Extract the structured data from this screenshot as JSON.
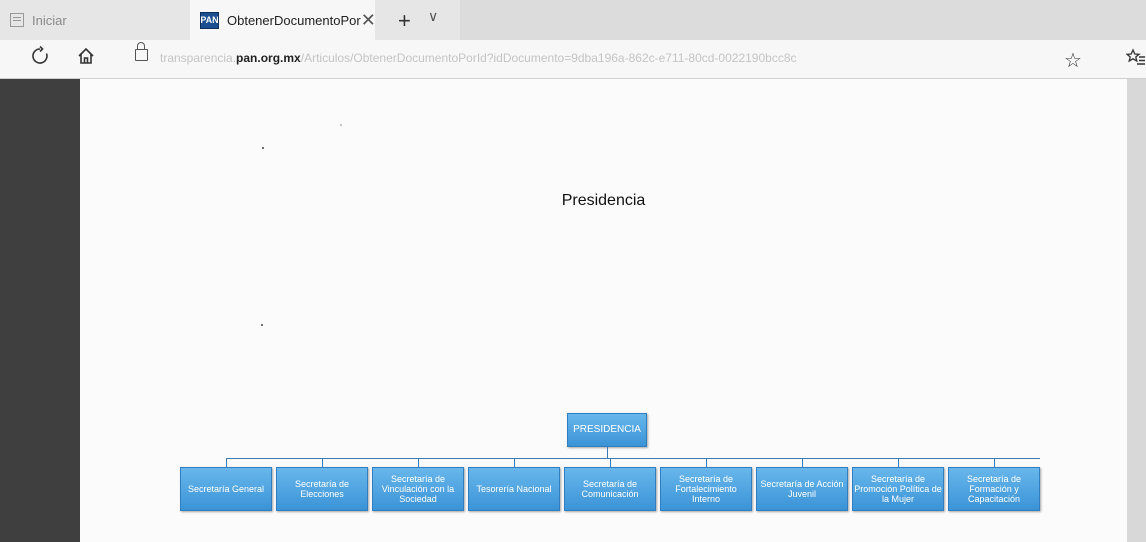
{
  "browser": {
    "inactive_tab_label": "Iniciar",
    "active_tab_label": "ObtenerDocumentoPor",
    "favicon_text": "PAN",
    "close_glyph": "✕",
    "new_tab_glyph": "+",
    "tab_list_glyph": "∨",
    "url_prefix": "transparencia.",
    "url_domain": "pan.org.mx",
    "url_path": "/Articulos/ObtenerDocumentoPorId?idDocumento=9dba196a-862c-e711-80cd-0022190bcc8c"
  },
  "icons": {
    "refresh": "refresh-icon",
    "home": "home-icon",
    "lock": "lock-icon",
    "favorite": "star-icon",
    "favorites_list": "favorites-list-icon"
  },
  "document": {
    "title": "Presidencia"
  },
  "org_chart": {
    "root": "PRESIDENCIA",
    "children": [
      "Secretaría General",
      "Secretaría de Elecciones",
      "Secretaría de Vinculación con la Sociedad",
      "Tesorería Nacional",
      "Secretaría de Comunicación",
      "Secretaría de Fortalecimiento Interno",
      "Secretaría de Acción Juvenil",
      "Secretaría de Promoción Política de la Mujer",
      "Secretaría de Formación y Capacitación"
    ]
  },
  "colors": {
    "box_fill": "#4aa3e0",
    "connector": "#3a7bb8",
    "page": "#fbfbfb",
    "viewer_background": "#3f3f3f"
  }
}
